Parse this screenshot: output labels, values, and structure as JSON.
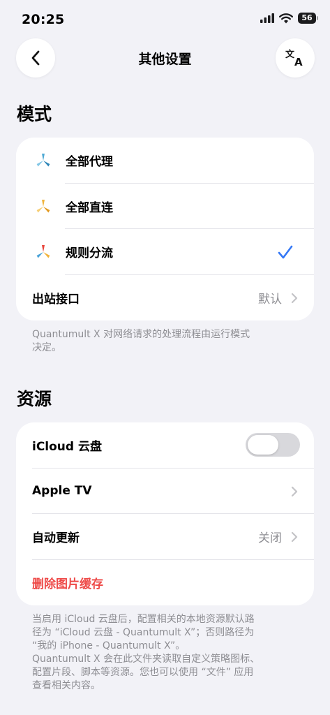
{
  "status_bar": {
    "time": "20:25",
    "battery_level": "56"
  },
  "nav": {
    "title": "其他设置",
    "back_icon": "chevron-left-icon",
    "translate_icon": "translate-icon"
  },
  "mode_section": {
    "header": "模式",
    "items": [
      {
        "label": "全部代理",
        "icon": "blue-triad-icon",
        "selected": false
      },
      {
        "label": "全部直连",
        "icon": "orange-triad-icon",
        "selected": false
      },
      {
        "label": "规则分流",
        "icon": "multicolor-triad-icon",
        "selected": true
      }
    ],
    "outbound": {
      "label": "出站接口",
      "value": "默认"
    },
    "footer": [
      "Quantumult X 对网络请求的处理流程由运行模式",
      "决定。"
    ]
  },
  "resource_section": {
    "header": "资源",
    "icloud": {
      "label": "iCloud 云盘",
      "enabled": false
    },
    "apple_tv": {
      "label": "Apple TV"
    },
    "auto_update": {
      "label": "自动更新",
      "value": "关闭"
    },
    "clear_cache": {
      "label": "删除图片缓存"
    },
    "footer": [
      "当启用 iCloud 云盘后，配置相关的本地资源默认路",
      "径为 “iCloud 云盘 - Quantumult X”；否则路径为",
      "“我的 iPhone - Quantumult X”。",
      "Quantumult X 会在此文件夹读取自定义策略图标、",
      "配置片段、脚本等资源。您也可以使用 “文件” 应用",
      "查看相关内容。"
    ]
  },
  "colors": {
    "accent": "#3478f6",
    "danger": "#ee4a48",
    "secondary_text": "#8e8e93",
    "background": "#f2f2f7"
  }
}
